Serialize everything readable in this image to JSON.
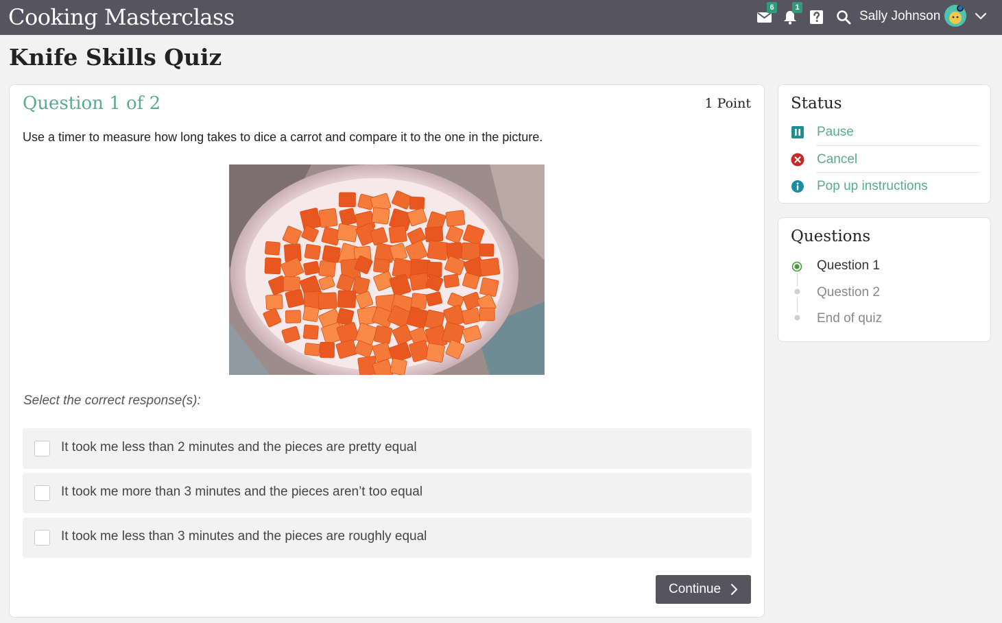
{
  "header": {
    "app_title": "Cooking Masterclass",
    "messages_count": "6",
    "notifications_count": "1",
    "user_name": "Sally Johnson"
  },
  "page": {
    "title": "Knife Skills Quiz"
  },
  "question": {
    "heading": "Question 1 of 2",
    "points": "1 Point",
    "text": "Use a timer to measure how long takes to dice a carrot and compare it to the one in the picture.",
    "instructions": "Select the correct response(s):",
    "options": [
      {
        "label": "It took me less than 2 minutes and the pieces are pretty equal",
        "checked": false
      },
      {
        "label": "It took me more than 3 minutes and the pieces aren’t too equal",
        "checked": false
      },
      {
        "label": "It took me less than 3 minutes and the pieces are roughly equal",
        "checked": false
      }
    ],
    "continue_label": "Continue"
  },
  "status_panel": {
    "title": "Status",
    "items": [
      {
        "label": "Pause",
        "icon": "pause-icon"
      },
      {
        "label": "Cancel",
        "icon": "cancel-icon"
      },
      {
        "label": "Pop up instructions",
        "icon": "info-icon"
      }
    ]
  },
  "questions_panel": {
    "title": "Questions",
    "items": [
      {
        "label": "Question 1",
        "state": "current"
      },
      {
        "label": "Question 2",
        "state": "pending"
      },
      {
        "label": "End of quiz",
        "state": "pending"
      }
    ]
  },
  "colors": {
    "topbar": "#55545f",
    "accent_green": "#5aaa8c",
    "badge_green": "#2e9b7a",
    "pause_teal": "#1e8e8e",
    "cancel_red": "#c62828",
    "info_teal": "#1a8ba0",
    "current_dot_green": "#3aa02b"
  }
}
